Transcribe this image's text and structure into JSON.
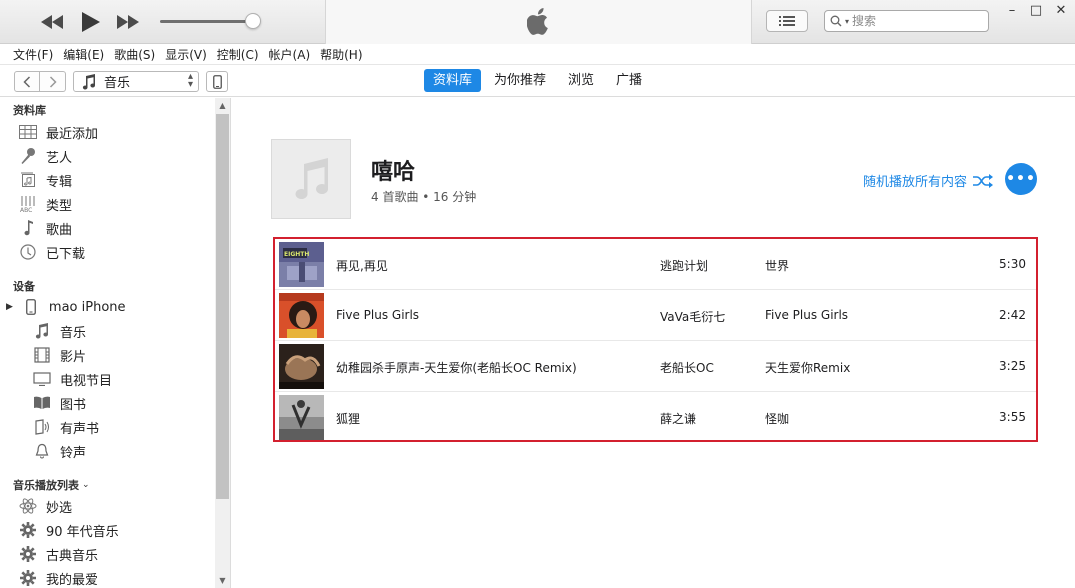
{
  "window": {
    "search_placeholder": "搜索",
    "controls": [
      "–",
      "□",
      "✕"
    ]
  },
  "menu": [
    "文件(F)",
    "编辑(E)",
    "歌曲(S)",
    "显示(V)",
    "控制(C)",
    "帐户(A)",
    "帮助(H)"
  ],
  "nav": {
    "media_kind": "音乐",
    "tabs": [
      {
        "label": "资料库",
        "active": true
      },
      {
        "label": "为你推荐",
        "active": false
      },
      {
        "label": "浏览",
        "active": false
      },
      {
        "label": "广播",
        "active": false
      }
    ]
  },
  "sidebar": {
    "library_header": "资料库",
    "library": [
      {
        "label": "最近添加",
        "icon": "grid-icon"
      },
      {
        "label": "艺人",
        "icon": "microphone-icon"
      },
      {
        "label": "专辑",
        "icon": "album-icon"
      },
      {
        "label": "类型",
        "icon": "genre-icon"
      },
      {
        "label": "歌曲",
        "icon": "note-icon"
      },
      {
        "label": "已下载",
        "icon": "download-icon"
      }
    ],
    "devices_header": "设备",
    "device_name": "mao iPhone",
    "device_items": [
      {
        "label": "音乐",
        "icon": "note-icon"
      },
      {
        "label": "影片",
        "icon": "film-icon"
      },
      {
        "label": "电视节目",
        "icon": "tv-icon"
      },
      {
        "label": "图书",
        "icon": "book-icon"
      },
      {
        "label": "有声书",
        "icon": "audiobook-icon"
      },
      {
        "label": "铃声",
        "icon": "bell-icon"
      }
    ],
    "playlists_header": "音乐播放列表",
    "playlists": [
      {
        "label": "妙选",
        "icon": "atom-icon"
      },
      {
        "label": "90 年代音乐",
        "icon": "gear-icon"
      },
      {
        "label": "古典音乐",
        "icon": "gear-icon"
      },
      {
        "label": "我的最爱",
        "icon": "gear-icon"
      }
    ]
  },
  "genre": {
    "title": "嘻哈",
    "meta": "4 首歌曲 • 16 分钟",
    "shuffle_label": "随机播放所有内容"
  },
  "songs": [
    {
      "name": "再见,再见",
      "artist": "逃跑计划",
      "album": "世界",
      "duration": "5:30"
    },
    {
      "name": "Five Plus Girls",
      "artist": "VaVa毛衍七",
      "album": "Five Plus Girls",
      "duration": "2:42"
    },
    {
      "name": "幼稚园杀手原声-天生爱你(老船长OC Remix)",
      "artist": "老船长OC",
      "album": "天生爱你Remix",
      "duration": "3:25"
    },
    {
      "name": "狐狸",
      "artist": "薛之谦",
      "album": "怪咖",
      "duration": "3:55"
    }
  ],
  "colors": {
    "accent": "#1e88e5",
    "highlight_border": "#d3202f"
  }
}
